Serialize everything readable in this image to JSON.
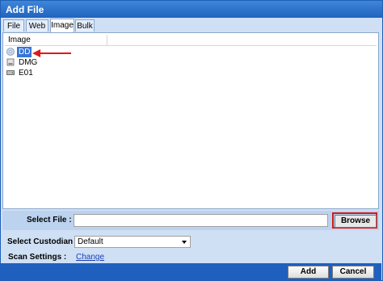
{
  "window": {
    "title": "Add File"
  },
  "tabs": [
    {
      "label": "File"
    },
    {
      "label": "Web"
    },
    {
      "label": "Image"
    },
    {
      "label": "Bulk"
    }
  ],
  "active_tab": "Image",
  "list": {
    "header": "Image",
    "items": [
      {
        "label": "DD",
        "icon": "disc-icon",
        "selected": true
      },
      {
        "label": "DMG",
        "icon": "disk-image-icon",
        "selected": false
      },
      {
        "label": "E01",
        "icon": "drive-icon",
        "selected": false
      }
    ]
  },
  "select_file": {
    "label": "Select File :",
    "value": "",
    "browse_label": "Browse"
  },
  "custodian": {
    "label": "Select Custodian :",
    "value": "Default"
  },
  "scan_settings": {
    "label": "Scan Settings :",
    "link": "Change"
  },
  "footer": {
    "add_label": "Add",
    "cancel_label": "Cancel"
  },
  "colors": {
    "title_bar": "#1f63c0",
    "selection": "#3875d7",
    "highlight": "#d11a1a"
  }
}
